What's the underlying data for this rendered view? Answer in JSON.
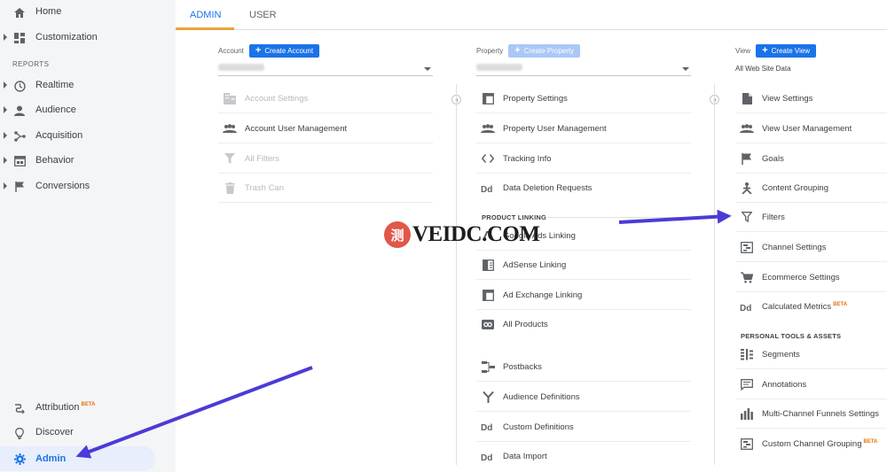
{
  "sidebar": {
    "home": "Home",
    "customization": "Customization",
    "reports_label": "REPORTS",
    "realtime": "Realtime",
    "audience": "Audience",
    "acquisition": "Acquisition",
    "behavior": "Behavior",
    "conversions": "Conversions",
    "attribution": "Attribution",
    "attribution_badge": "BETA",
    "discover": "Discover",
    "admin": "Admin"
  },
  "tabs": {
    "admin": "ADMIN",
    "user": "USER"
  },
  "account": {
    "label": "Account",
    "create_label": "Create Account",
    "items": [
      "Account Settings",
      "Account User Management",
      "All Filters",
      "Trash Can"
    ]
  },
  "property": {
    "label": "Property",
    "create_label": "Create Property",
    "items": [
      "Property Settings",
      "Property User Management",
      "Tracking Info",
      "Data Deletion Requests"
    ],
    "product_linking_label": "PRODUCT LINKING",
    "linking_items": [
      "Google Ads Linking",
      "AdSense Linking",
      "Ad Exchange Linking",
      "All Products"
    ],
    "other_items": [
      "Postbacks",
      "Audience Definitions",
      "Custom Definitions",
      "Data Import"
    ]
  },
  "view": {
    "label": "View",
    "create_label": "Create View",
    "selected": "All Web Site Data",
    "items": [
      "View Settings",
      "View User Management",
      "Goals",
      "Content Grouping",
      "Filters",
      "Channel Settings",
      "Ecommerce Settings",
      "Calculated Metrics"
    ],
    "calculated_badge": "BETA",
    "personal_label": "PERSONAL TOOLS & ASSETS",
    "personal_items": [
      "Segments",
      "Annotations",
      "Multi-Channel Funnels Settings",
      "Custom Channel Grouping"
    ],
    "custom_channel_badge": "BETA"
  },
  "watermark": {
    "glyph": "测",
    "text": "VEIDC.COM"
  },
  "colors": {
    "accent": "#1a73e8",
    "arrow": "#4b3bd6",
    "tab_underline": "#e8a33c",
    "beta": "#e8710a"
  }
}
